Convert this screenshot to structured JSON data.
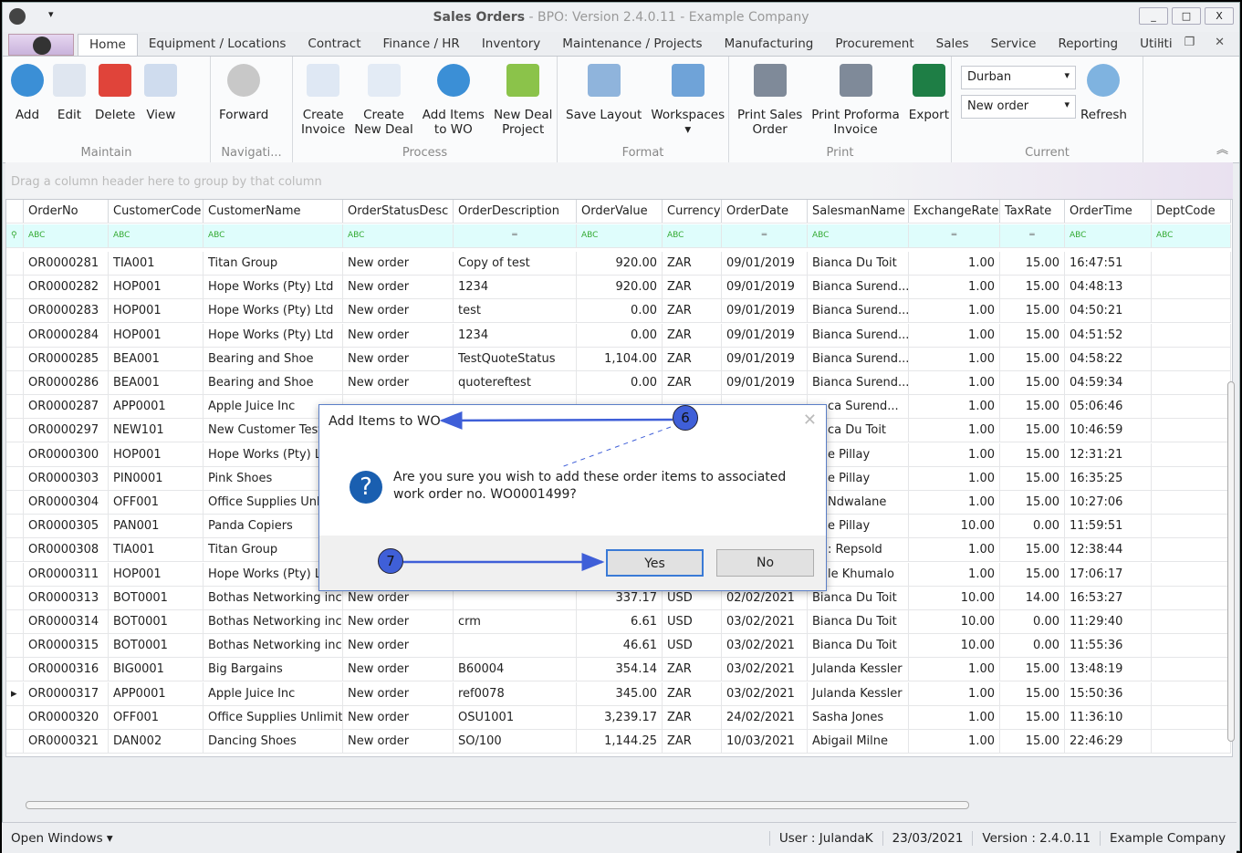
{
  "window": {
    "title_main": "Sales Orders",
    "title_rest": " - BPO: Version 2.4.0.11 - Example Company",
    "controls": [
      "_",
      "□",
      "X"
    ]
  },
  "tabs": [
    "Home",
    "Equipment / Locations",
    "Contract",
    "Finance / HR",
    "Inventory",
    "Maintenance / Projects",
    "Manufacturing",
    "Procurement",
    "Sales",
    "Service",
    "Reporting",
    "Utiliti"
  ],
  "ribbon": {
    "groups": [
      {
        "label": "Maintain",
        "buttons": [
          {
            "label": "Add",
            "icon": "add-icon",
            "color": "#3b8fd6"
          },
          {
            "label": "Edit",
            "icon": "edit-icon",
            "color": "#dfe6f0"
          },
          {
            "label": "Delete",
            "icon": "delete-icon",
            "color": "#e0443a"
          },
          {
            "label": "View",
            "icon": "view-icon",
            "color": "#cfdcee"
          }
        ]
      },
      {
        "label": "Navigati...",
        "buttons": [
          {
            "label": "Forward",
            "icon": "forward-icon",
            "color": "#c8c8c8"
          }
        ]
      },
      {
        "label": "Process",
        "buttons": [
          {
            "label": "Create\nInvoice",
            "icon": "create-invoice-icon",
            "color": "#dfe8f4"
          },
          {
            "label": "Create\nNew Deal",
            "icon": "create-deal-icon",
            "color": "#e3ebf5"
          },
          {
            "label": "Add Items\nto WO",
            "icon": "add-items-icon",
            "color": "#3b8fd6"
          },
          {
            "label": "New Deal\nProject",
            "icon": "deal-project-icon",
            "color": "#8bc34a"
          }
        ]
      },
      {
        "label": "Format",
        "buttons": [
          {
            "label": "Save Layout",
            "icon": "save-layout-icon",
            "color": "#8fb4dc"
          },
          {
            "label": "Workspaces\n▾",
            "icon": "workspaces-icon",
            "color": "#6fa3d8"
          }
        ]
      },
      {
        "label": "Print",
        "buttons": [
          {
            "label": "Print Sales\nOrder",
            "icon": "print-icon",
            "color": "#7f8a99"
          },
          {
            "label": "Print Proforma\nInvoice",
            "icon": "print-icon",
            "color": "#7f8a99"
          },
          {
            "label": "Export",
            "icon": "export-xlsx-icon",
            "color": "#1e7e45"
          }
        ]
      }
    ],
    "current": {
      "label": "Current",
      "branch": "Durban",
      "status": "New order",
      "refresh": "Refresh"
    }
  },
  "grid": {
    "group_hint": "Drag a column header here to group by that column",
    "columns": [
      "OrderNo",
      "CustomerCode",
      "CustomerName",
      "OrderStatusDesc",
      "OrderDescription",
      "OrderValue",
      "Currency",
      "OrderDate",
      "SalesmanName",
      "ExchangeRate",
      "TaxRate",
      "OrderTime",
      "DeptCode"
    ],
    "rows": [
      [
        "OR0000281",
        "TIA001",
        "Titan Group",
        "New order",
        "Copy of test",
        "920.00",
        "ZAR",
        "09/01/2019",
        "Bianca Du Toit",
        "1.00",
        "15.00",
        "16:47:51",
        ""
      ],
      [
        "OR0000282",
        "HOP001",
        "Hope Works (Pty) Ltd",
        "New order",
        "1234",
        "920.00",
        "ZAR",
        "09/01/2019",
        "Bianca Surend...",
        "1.00",
        "15.00",
        "04:48:13",
        ""
      ],
      [
        "OR0000283",
        "HOP001",
        "Hope Works (Pty) Ltd",
        "New order",
        "test",
        "0.00",
        "ZAR",
        "09/01/2019",
        "Bianca Surend...",
        "1.00",
        "15.00",
        "04:50:21",
        ""
      ],
      [
        "OR0000284",
        "HOP001",
        "Hope Works (Pty) Ltd",
        "New order",
        "1234",
        "0.00",
        "ZAR",
        "09/01/2019",
        "Bianca Surend...",
        "1.00",
        "15.00",
        "04:51:52",
        ""
      ],
      [
        "OR0000285",
        "BEA001",
        "Bearing and Shoe",
        "New order",
        "TestQuoteStatus",
        "1,104.00",
        "ZAR",
        "09/01/2019",
        "Bianca Surend...",
        "1.00",
        "15.00",
        "04:58:22",
        ""
      ],
      [
        "OR0000286",
        "BEA001",
        "Bearing and Shoe",
        "New order",
        "quotereftest",
        "0.00",
        "ZAR",
        "09/01/2019",
        "Bianca Surend...",
        "1.00",
        "15.00",
        "04:59:34",
        ""
      ],
      [
        "OR0000287",
        "APP0001",
        "Apple Juice Inc",
        "",
        "",
        "",
        "",
        "",
        "ca Surend...",
        "1.00",
        "15.00",
        "05:06:46",
        ""
      ],
      [
        "OR0000297",
        "NEW101",
        "New Customer Test",
        "",
        "",
        "",
        "",
        "",
        "ca Du Toit",
        "1.00",
        "15.00",
        "10:46:59",
        ""
      ],
      [
        "OR0000300",
        "HOP001",
        "Hope Works (Pty) Lt",
        "",
        "",
        "",
        "",
        "",
        "e Pillay",
        "1.00",
        "15.00",
        "12:31:21",
        ""
      ],
      [
        "OR0000303",
        "PIN0001",
        "Pink Shoes",
        "",
        "",
        "",
        "",
        "",
        "e Pillay",
        "1.00",
        "15.00",
        "16:35:25",
        ""
      ],
      [
        "OR0000304",
        "OFF001",
        "Office Supplies Unlin",
        "",
        "",
        "",
        "",
        "",
        "Ndwalane",
        "1.00",
        "15.00",
        "10:27:06",
        ""
      ],
      [
        "OR0000305",
        "PAN001",
        "Panda Copiers",
        "",
        "",
        "",
        "",
        "",
        "e Pillay",
        "10.00",
        "0.00",
        "11:59:51",
        ""
      ],
      [
        "OR0000308",
        "TIA001",
        "Titan Group",
        "",
        "",
        "",
        "",
        "",
        ": Repsold",
        "1.00",
        "15.00",
        "12:38:44",
        ""
      ],
      [
        "OR0000311",
        "HOP001",
        "Hope Works (Pty) Lt",
        "",
        "",
        "",
        "",
        "",
        "le Khumalo",
        "1.00",
        "15.00",
        "17:06:17",
        ""
      ],
      [
        "OR0000313",
        "BOT0001",
        "Bothas Networking inc",
        "New order",
        "",
        "337.17",
        "USD",
        "02/02/2021",
        "Bianca Du Toit",
        "10.00",
        "14.00",
        "16:53:27",
        ""
      ],
      [
        "OR0000314",
        "BOT0001",
        "Bothas Networking inc",
        "New order",
        "crm",
        "6.61",
        "USD",
        "03/02/2021",
        "Bianca Du Toit",
        "10.00",
        "0.00",
        "11:29:40",
        ""
      ],
      [
        "OR0000315",
        "BOT0001",
        "Bothas Networking inc",
        "New order",
        "",
        "46.61",
        "USD",
        "03/02/2021",
        "Bianca Du Toit",
        "10.00",
        "0.00",
        "11:55:36",
        ""
      ],
      [
        "OR0000316",
        "BIG0001",
        "Big Bargains",
        "New order",
        "B60004",
        "354.14",
        "ZAR",
        "03/02/2021",
        "Julanda Kessler",
        "1.00",
        "15.00",
        "13:48:19",
        ""
      ],
      [
        "OR0000317",
        "APP0001",
        "Apple Juice Inc",
        "New order",
        "ref0078",
        "345.00",
        "ZAR",
        "03/02/2021",
        "Julanda Kessler",
        "1.00",
        "15.00",
        "15:50:36",
        ""
      ],
      [
        "OR0000320",
        "OFF001",
        "Office Supplies Unlimit...",
        "New order",
        "OSU1001",
        "3,239.17",
        "ZAR",
        "24/02/2021",
        "Sasha Jones",
        "1.00",
        "15.00",
        "11:36:10",
        ""
      ],
      [
        "OR0000321",
        "DAN002",
        "Dancing Shoes",
        "New order",
        "SO/100",
        "1,144.25",
        "ZAR",
        "10/03/2021",
        "Abigail Milne",
        "1.00",
        "15.00",
        "22:46:29",
        ""
      ]
    ],
    "current_row_index": 18
  },
  "dialog": {
    "title": "Add Items to WO",
    "message": "Are you sure you wish to add these order items to associated work order no. WO0001499?",
    "yes": "Yes",
    "no": "No"
  },
  "annotations": [
    "6",
    "7"
  ],
  "status": {
    "open_windows": "Open Windows ▾",
    "user": "User : JulandaK",
    "date": "23/03/2021",
    "version": "Version : 2.4.0.11",
    "company": "Example Company"
  }
}
